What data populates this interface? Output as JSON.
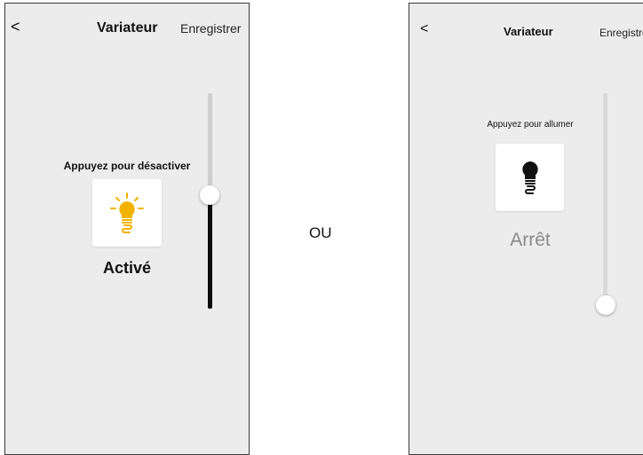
{
  "left_screen": {
    "back_glyph": "<",
    "title": "Variateur",
    "save_label": "Enregistrer",
    "hint": "Appuyez pour désactiver",
    "state": "Activé",
    "bulb_icon": "bulb-on-icon",
    "bulb_color": "#f2b200",
    "dimmer_level_percent": 55
  },
  "separator": "OU",
  "right_screen": {
    "back_glyph": "<",
    "title": "Variateur",
    "save_label": "Enregistre",
    "hint": "Appuyez pour allumer",
    "state": "Arrêt",
    "bulb_icon": "bulb-off-icon",
    "bulb_color": "#111111",
    "dimmer_level_percent": 0
  }
}
